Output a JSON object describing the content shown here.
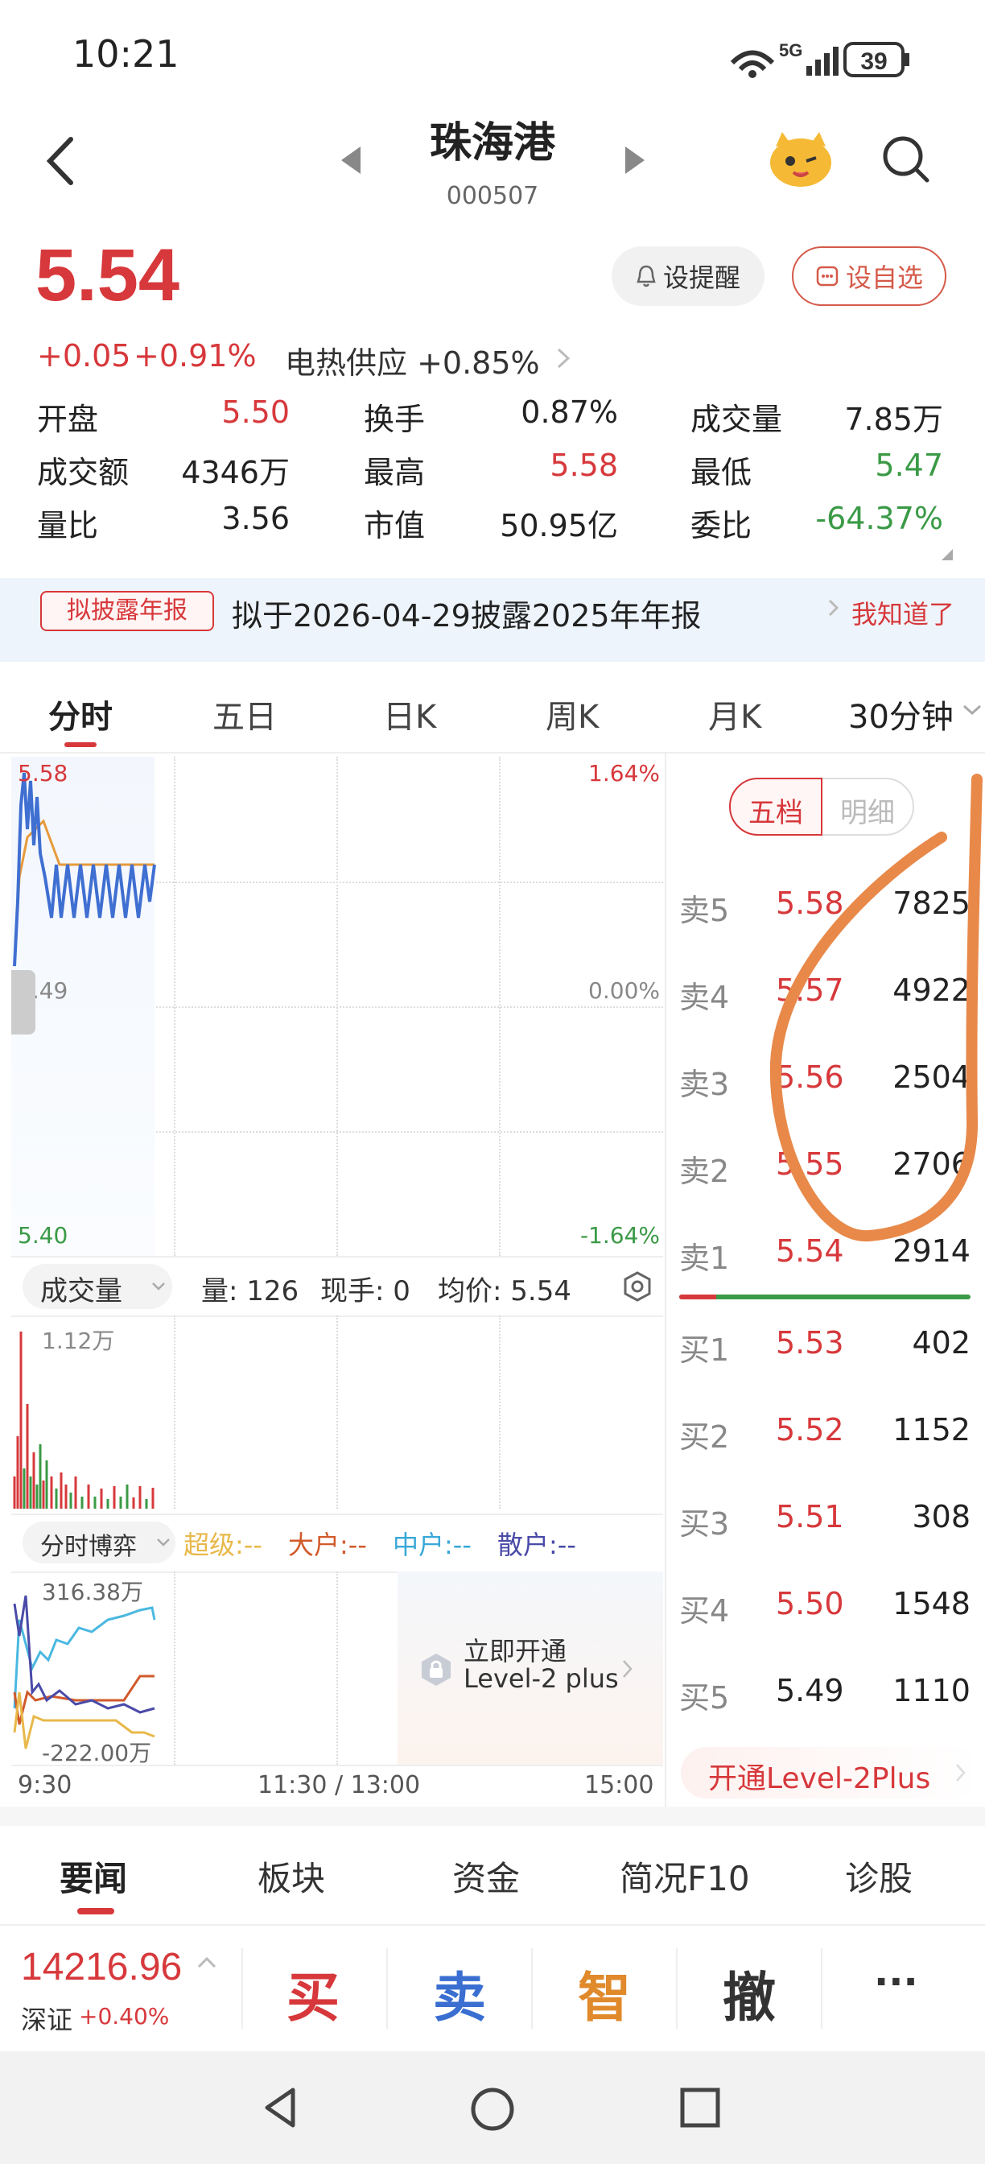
{
  "status_bar": {
    "time": "10:21",
    "network": "5G",
    "battery": "39"
  },
  "header": {
    "title": "珠海港",
    "code": "000507"
  },
  "quote": {
    "price": "5.54",
    "change": "+0.05",
    "change_pct": "+0.91%",
    "sector": "电热供应 +0.85%",
    "alert_label": "设提醒",
    "fav_label": "设自选"
  },
  "stats": {
    "open_label": "开盘",
    "open": "5.50",
    "turnover_label": "换手",
    "turnover": "0.87%",
    "volume_label": "成交量",
    "volume": "7.85万",
    "amount_label": "成交额",
    "amount": "4346万",
    "high_label": "最高",
    "high": "5.58",
    "low_label": "最低",
    "low": "5.47",
    "vol_ratio_label": "量比",
    "vol_ratio": "3.56",
    "mcap_label": "市值",
    "mcap": "50.95亿",
    "bid_ratio_label": "委比",
    "bid_ratio": "-64.37%"
  },
  "notice": {
    "tag": "拟披露年报",
    "text": "拟于2026-04-29披露2025年年报",
    "dismiss": "我知道了"
  },
  "tabs": [
    "分时",
    "五日",
    "日K",
    "周K",
    "月K",
    "30分钟"
  ],
  "chart": {
    "y_top": "5.58",
    "y_mid": "5.49",
    "y_bot": "5.40",
    "pct_top": "1.64%",
    "pct_mid": "0.00%",
    "pct_bot": "-1.64%",
    "vol_selector": "成交量",
    "vol_info": "量: 126",
    "hand_info": "现手: 0",
    "avg_info": "均价: 5.54",
    "vol_max": "1.12万",
    "game_selector": "分时博弈",
    "game_super": "超级:--",
    "game_big": "大户:--",
    "game_mid": "中户:--",
    "game_retail": "散户:--",
    "game_top": "316.38万",
    "game_bot": "-222.00万",
    "upgrade_line1": "立即开通",
    "upgrade_line2": "Level-2 plus",
    "time_start": "9:30",
    "time_mid": "11:30 / 13:00",
    "time_end": "15:00"
  },
  "orderbook": {
    "tab_five": "五档",
    "tab_detail": "明细",
    "asks": [
      {
        "label": "卖5",
        "price": "5.58",
        "vol": "7825"
      },
      {
        "label": "卖4",
        "price": "5.57",
        "vol": "4922"
      },
      {
        "label": "卖3",
        "price": "5.56",
        "vol": "2504"
      },
      {
        "label": "卖2",
        "price": "5.55",
        "vol": "2706"
      },
      {
        "label": "卖1",
        "price": "5.54",
        "vol": "2914"
      }
    ],
    "bids": [
      {
        "label": "买1",
        "price": "5.53",
        "vol": "402"
      },
      {
        "label": "买2",
        "price": "5.52",
        "vol": "1152"
      },
      {
        "label": "买3",
        "price": "5.51",
        "vol": "308"
      },
      {
        "label": "买4",
        "price": "5.50",
        "vol": "1548"
      },
      {
        "label": "买5",
        "price": "5.49",
        "vol": "1110"
      }
    ],
    "upgrade": "开通Level-2Plus"
  },
  "bottom_tabs": [
    "要闻",
    "板块",
    "资金",
    "简况F10",
    "诊股"
  ],
  "index": {
    "value": "14216.96",
    "name": "深证",
    "change": "+0.40%"
  },
  "actions": {
    "buy": "买",
    "sell": "卖",
    "smart": "智",
    "cancel": "撤",
    "more": "···"
  },
  "colors": {
    "up": "#d7383b",
    "down": "#3a9a46",
    "annotation": "#e8894a"
  }
}
